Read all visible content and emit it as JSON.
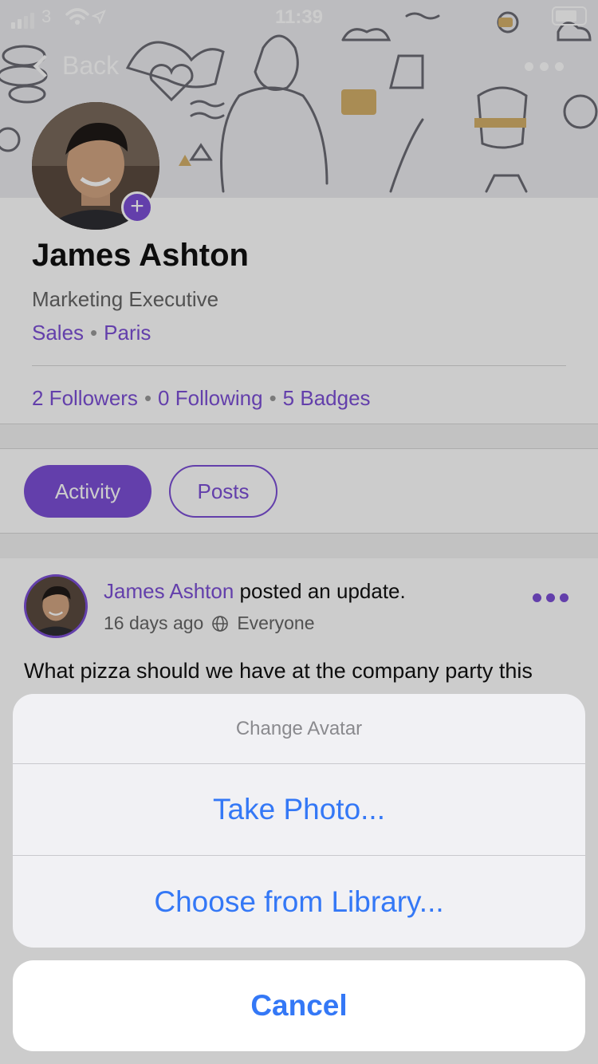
{
  "status_bar": {
    "carrier": "3",
    "time": "11:39"
  },
  "nav": {
    "back_label": "Back"
  },
  "profile": {
    "name": "James Ashton",
    "job_title": "Marketing Executive",
    "department": "Sales",
    "location": "Paris",
    "followers": "2 Followers",
    "following": "0 Following",
    "badges": "5 Badges"
  },
  "tabs": [
    {
      "label": "Activity"
    },
    {
      "label": "Posts"
    }
  ],
  "post": {
    "author": "James Ashton",
    "action": "posted an update.",
    "time": "16 days ago",
    "audience": "Everyone",
    "text": "What pizza should we have at the company party this"
  },
  "action_sheet": {
    "title": "Change Avatar",
    "actions": [
      "Take Photo...",
      "Choose from Library..."
    ],
    "cancel_label": "Cancel"
  },
  "colors": {
    "accent": "#7c4fd6",
    "ios_blue": "#3478f6"
  },
  "icons": {
    "status": [
      "signal-icon",
      "wifi-icon",
      "location-icon",
      "battery-icon"
    ],
    "nav": [
      "back-chevron-icon",
      "more-dots-icon"
    ],
    "post": [
      "globe-icon",
      "post-more-icon"
    ],
    "avatar": [
      "add-avatar-icon"
    ]
  }
}
